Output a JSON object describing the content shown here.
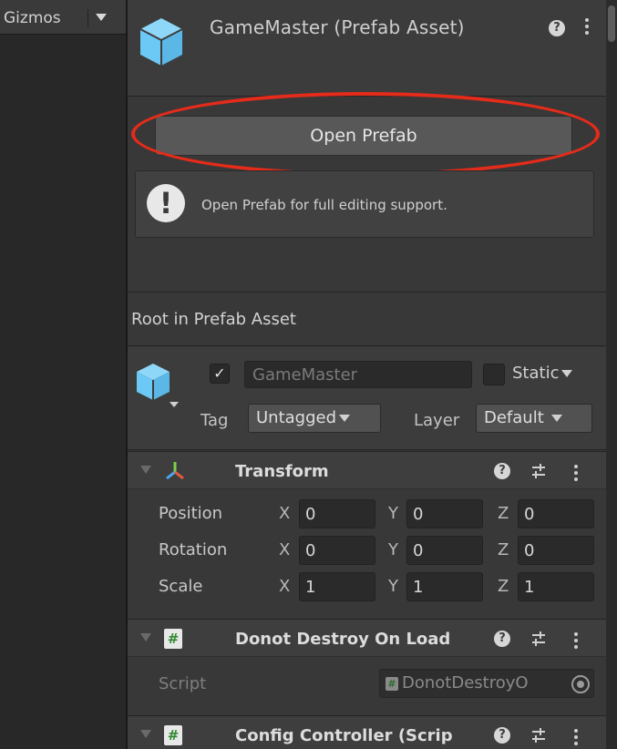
{
  "scene": {
    "gizmos_label": "Gizmos"
  },
  "header": {
    "title": "GameMaster (Prefab Asset)",
    "help": "?"
  },
  "open_prefab": {
    "button_label": "Open Prefab",
    "info_message": "Open Prefab for full editing support."
  },
  "root_label": "Root in Prefab Asset",
  "game_object": {
    "active": true,
    "check_glyph": "✓",
    "name": "GameMaster",
    "static_label": "Static",
    "static": false,
    "tag_label": "Tag",
    "tag_value": "Untagged",
    "layer_label": "Layer",
    "layer_value": "Default"
  },
  "components": [
    {
      "title": "Transform",
      "rows": [
        {
          "label": "Position",
          "x": "0",
          "y": "0",
          "z": "0"
        },
        {
          "label": "Rotation",
          "x": "0",
          "y": "0",
          "z": "0"
        },
        {
          "label": "Scale",
          "x": "1",
          "y": "1",
          "z": "1"
        }
      ],
      "axis_labels": [
        "X",
        "Y",
        "Z"
      ]
    },
    {
      "title": "Donot Destroy On Load",
      "script_label": "Script",
      "script_value": "DonotDestroyO",
      "script_glyph": "#"
    },
    {
      "title": "Config Controller (Scrip",
      "script_glyph": "#"
    }
  ],
  "colors": {
    "highlight": "#e52b1a",
    "prefab_icon": "#6cc8f5",
    "panel": "#383838"
  }
}
